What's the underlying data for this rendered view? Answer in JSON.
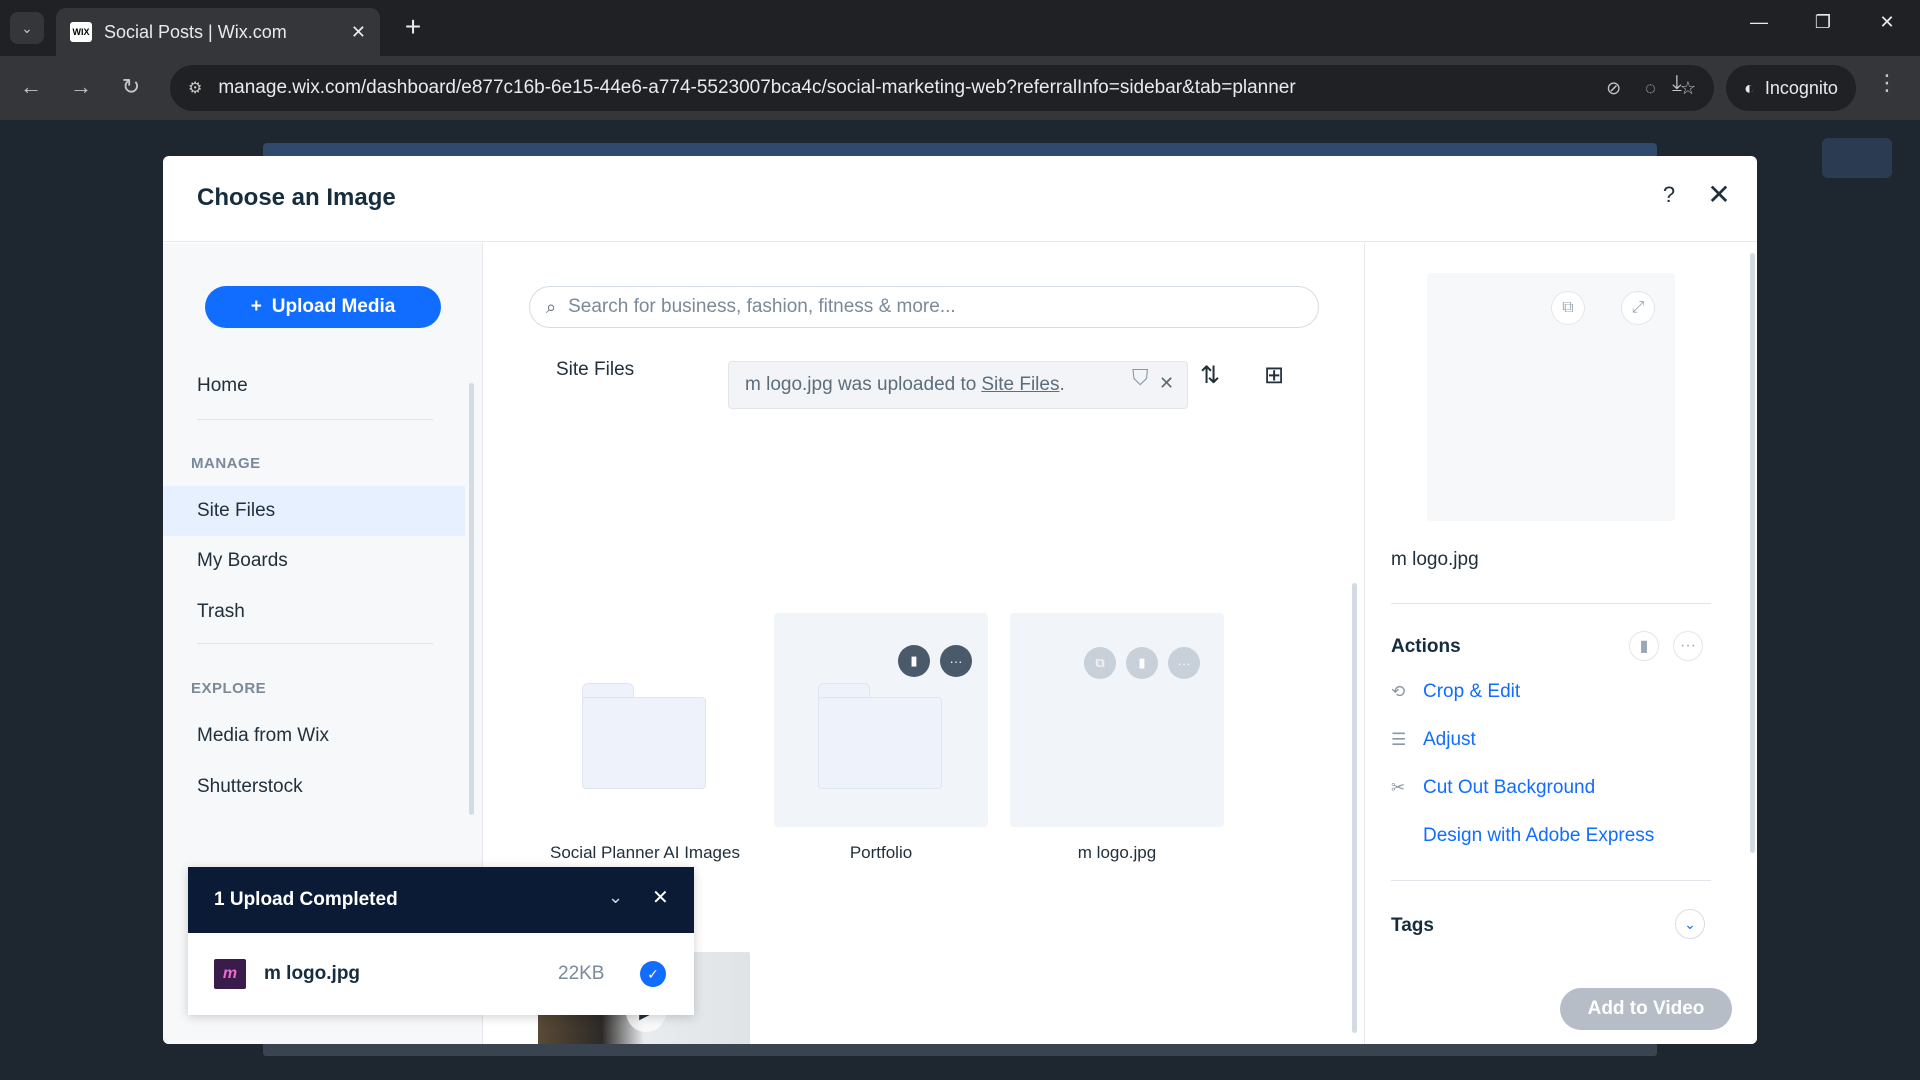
{
  "browser": {
    "tab_title": "Social Posts | Wix.com",
    "favicon_text": "WIX",
    "url": "manage.wix.com/dashboard/e877c16b-6e15-44e6-a774-5523007bca4c/social-marketing-web?referralInfo=sidebar&tab=planner",
    "incognito_label": "Incognito"
  },
  "modal": {
    "title": "Choose an Image"
  },
  "sidebar": {
    "upload_label": "Upload Media",
    "home": "Home",
    "manage_header": "MANAGE",
    "manage_items": [
      "Site Files",
      "My Boards",
      "Trash"
    ],
    "explore_header": "EXPLORE",
    "explore_items": [
      "Media from Wix",
      "Shutterstock"
    ]
  },
  "main": {
    "search_placeholder": "Search for business, fashion, fitness & more...",
    "breadcrumb": "Site Files",
    "toast_text": "m logo.jpg was uploaded to",
    "toast_link": "Site Files",
    "toast_suffix": ".",
    "tiles": [
      {
        "label": "Social Planner AI Images"
      },
      {
        "label": "Portfolio"
      },
      {
        "label": "m logo.jpg"
      }
    ]
  },
  "details": {
    "file_name": "m logo.jpg",
    "actions_title": "Actions",
    "actions": [
      "Crop & Edit",
      "Adjust",
      "Cut Out Background",
      "Design with Adobe Express"
    ],
    "tags_title": "Tags",
    "primary_button": "Add to Video"
  },
  "upload": {
    "title": "1 Upload Completed",
    "file_name": "m logo.jpg",
    "file_size": "22KB",
    "thumb_text": "m"
  }
}
